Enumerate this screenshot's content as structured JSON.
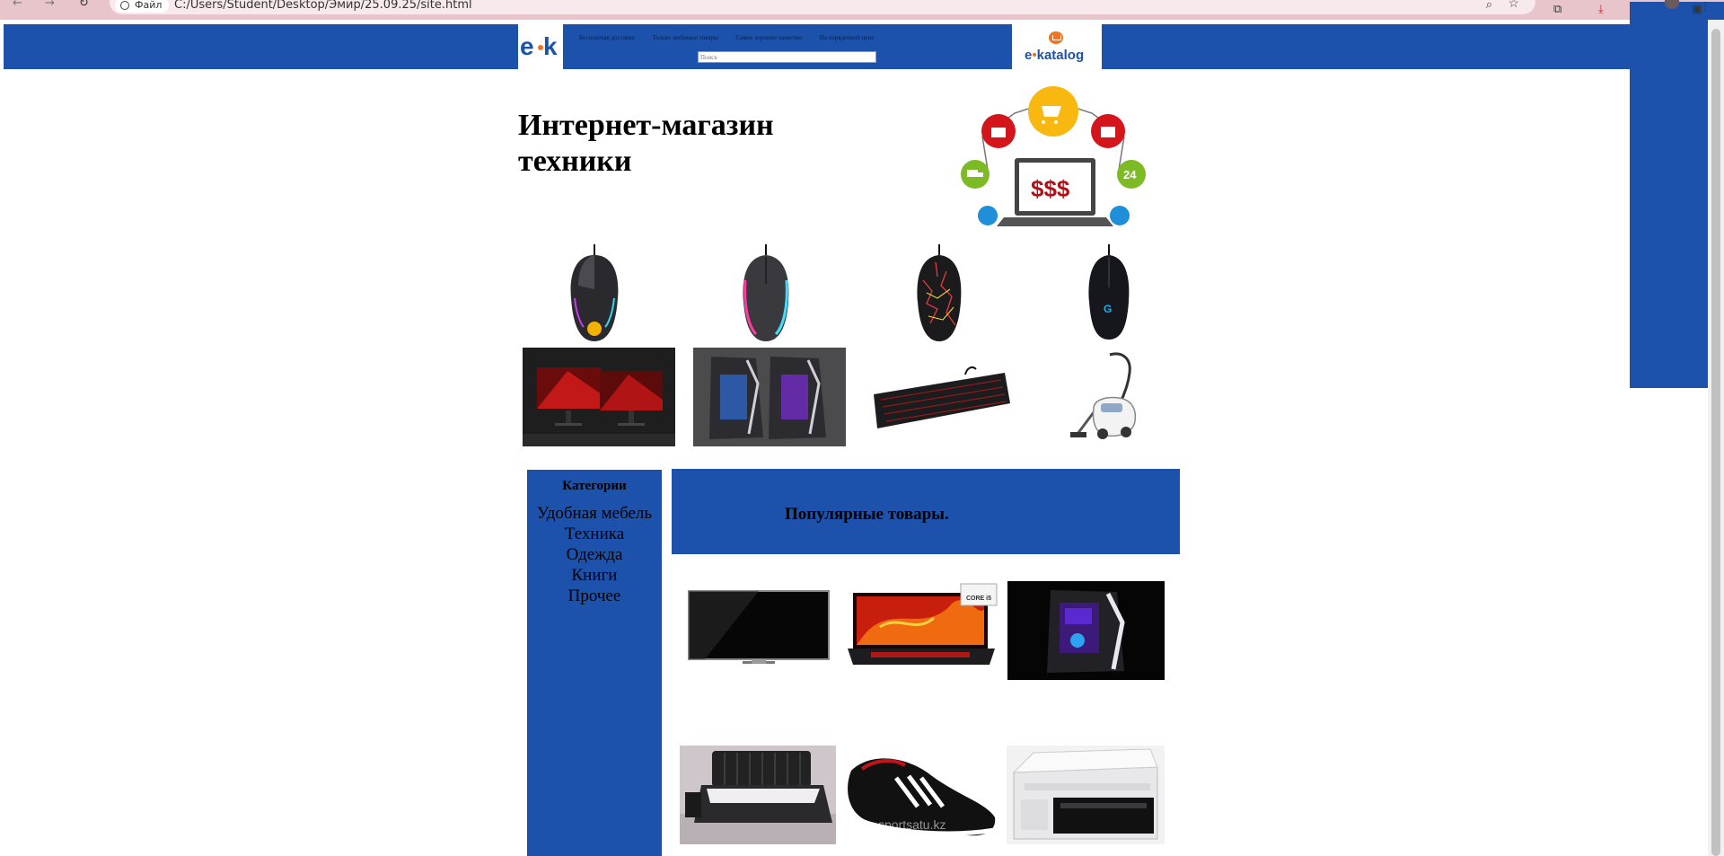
{
  "browser": {
    "chip_label": "Файл",
    "url": "C:/Users/Student/Desktop/Эмир/25.09.25/site.html"
  },
  "header": {
    "menu_links": [
      "Бесплатная доставка",
      "Только любимые товары",
      "Самое хорошее качество",
      "На порядочной цене"
    ],
    "search_placeholder": "Поиск",
    "ekatalog_logo": {
      "prefix": "e",
      "dot": "•",
      "suffix": "katalog"
    }
  },
  "hero": {
    "title": "Интернет-магазин техники",
    "badge_24": "24",
    "laptop_text": "$$$"
  },
  "showcase": {
    "row1_icons": [
      "gaming-mouse-steelseries",
      "gaming-mouse-rgb",
      "gaming-mouse-crackle",
      "gaming-mouse-logitech"
    ],
    "row2_icons": [
      "dual-monitors",
      "gaming-pc-cases",
      "mechanical-keyboard",
      "vacuum-cleaner"
    ]
  },
  "sidebar": {
    "heading": "Категории",
    "items": [
      "Удобная мебель",
      "Техника",
      "Одежда",
      "Книги",
      "Прочее"
    ]
  },
  "popular": {
    "title": "Популярные товары.",
    "laptop_badge": "CORE i5",
    "watermark": "sportsatu.kz",
    "products": [
      "tv",
      "gaming-laptop",
      "gaming-pc",
      "leather-bed",
      "football-boots",
      "gas-stove"
    ]
  },
  "colors": {
    "brand_blue": "#1c52ab",
    "brand_orange": "#f37321",
    "chrome_pink": "#e8c5cb"
  }
}
